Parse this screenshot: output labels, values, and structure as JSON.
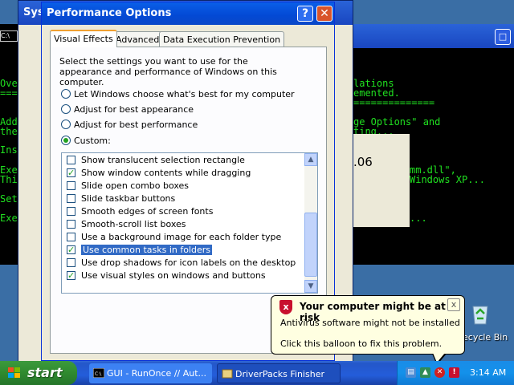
{
  "background": {
    "sysprops_title": "Sys",
    "console_left": [
      "Ove",
      "===",
      "Add",
      "the",
      "Ins",
      "Exe",
      "Thi",
      "Set",
      "Exe"
    ],
    "console_right": [
      "lations",
      "emented.",
      "==============",
      "ge Options\" and",
      "ting...",
      "mm.dll\",",
      "Windows XP...",
      "..."
    ],
    "gray_number": ".06"
  },
  "dialog": {
    "title": "Performance Options",
    "help_label": "?",
    "close_label": "✕",
    "tabs": [
      "Visual Effects",
      "Advanced",
      "Data Execution Prevention"
    ],
    "description": "Select the settings you want to use for the appearance and performance of Windows on this computer.",
    "radios": [
      {
        "label": "Let Windows choose what's best for my computer",
        "selected": false
      },
      {
        "label": "Adjust for best appearance",
        "selected": false
      },
      {
        "label": "Adjust for best performance",
        "selected": false
      },
      {
        "label": "Custom:",
        "selected": true
      }
    ],
    "effects": [
      {
        "label": "Show translucent selection rectangle",
        "checked": false
      },
      {
        "label": "Show window contents while dragging",
        "checked": true
      },
      {
        "label": "Slide open combo boxes",
        "checked": false
      },
      {
        "label": "Slide taskbar buttons",
        "checked": false
      },
      {
        "label": "Smooth edges of screen fonts",
        "checked": false
      },
      {
        "label": "Smooth-scroll list boxes",
        "checked": false
      },
      {
        "label": "Use a background image for each folder type",
        "checked": false
      },
      {
        "label": "Use common tasks in folders",
        "checked": true,
        "highlighted": true
      },
      {
        "label": "Use drop shadows for icon labels on the desktop",
        "checked": false
      },
      {
        "label": "Use visual styles on windows and buttons",
        "checked": true
      }
    ]
  },
  "balloon": {
    "title": "Your computer might be at risk",
    "line1": "Antivirus software might not be installed",
    "line2": "Click this balloon to fix this problem.",
    "close_label": "x"
  },
  "desktop": {
    "recycle_label": "ecycle Bin"
  },
  "taskbar": {
    "start_label": "start",
    "tasks": [
      "GUI - RunOnce // Aut...",
      "DriverPacks Finisher"
    ],
    "clock": "3:14 AM"
  },
  "colors": {
    "xp_blue": "#0a5fe8",
    "console_text": "#20e020",
    "selection": "#316ac5",
    "balloon_bg": "#ffffe1"
  }
}
